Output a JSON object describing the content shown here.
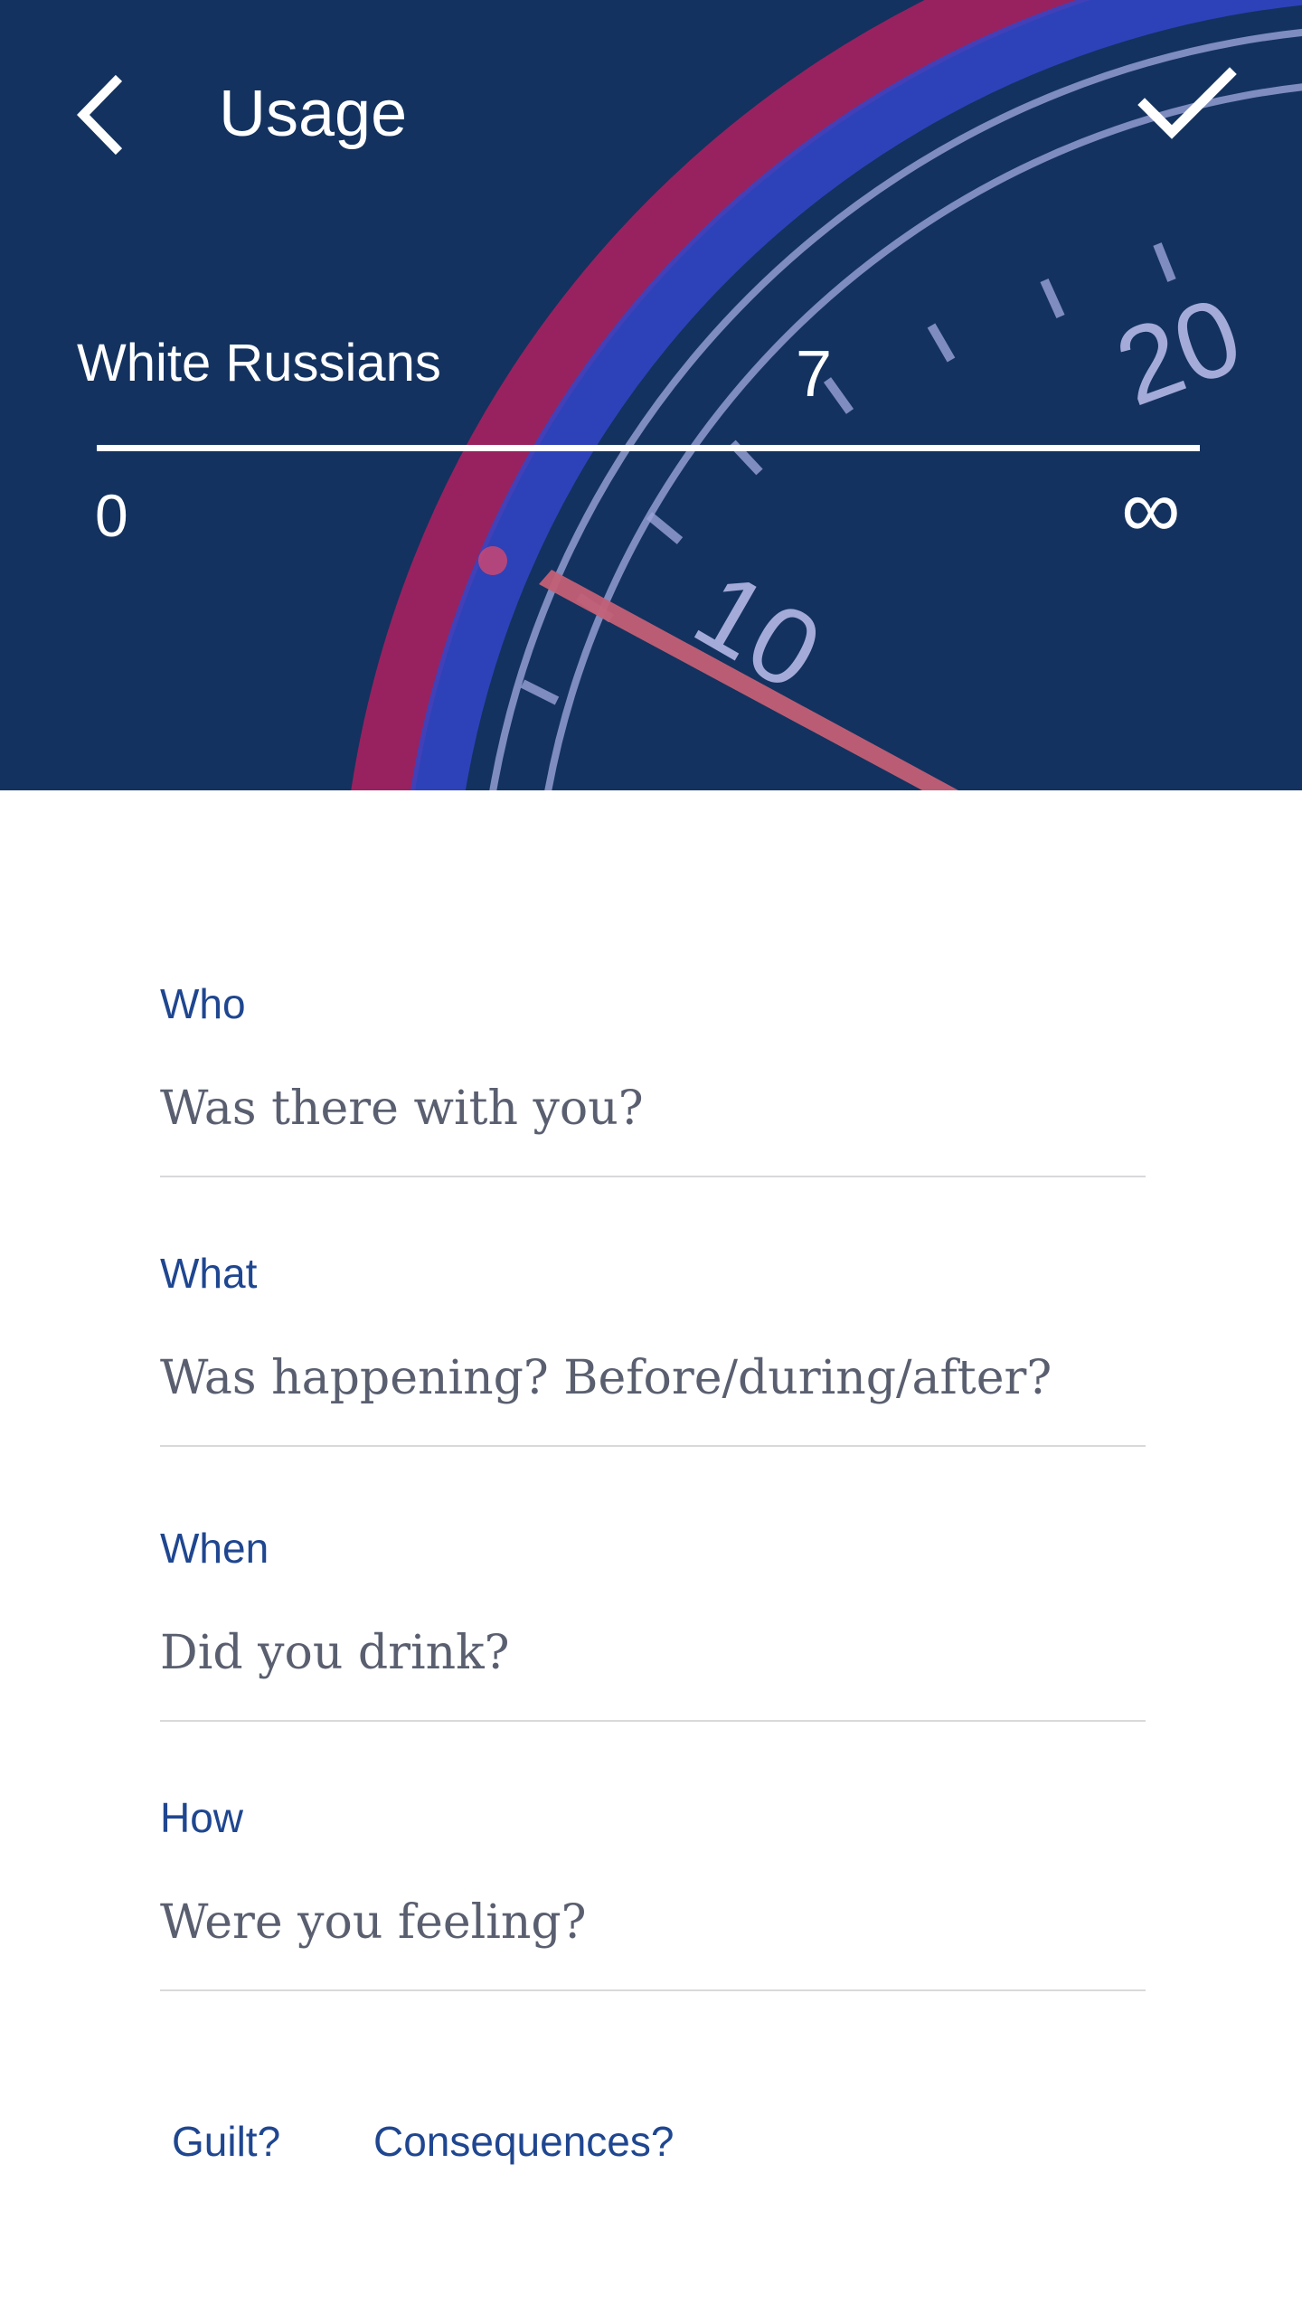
{
  "header": {
    "title": "Usage",
    "drink_name": "White Russians",
    "count": "7",
    "slider": {
      "min_label": "0",
      "max_label": "∞",
      "value": 7
    },
    "gauge_labels": [
      "20",
      "10"
    ]
  },
  "fields": [
    {
      "label": "Who",
      "placeholder": "Was there with you?"
    },
    {
      "label": "What",
      "placeholder": "Was happening? Before/during/after?"
    },
    {
      "label": "When",
      "placeholder": "Did you drink?"
    },
    {
      "label": "How",
      "placeholder": "Were you feeling?"
    }
  ],
  "links": {
    "guilt": "Guilt?",
    "consequences": "Consequences?"
  },
  "colors": {
    "header_bg": "#13325f",
    "accent": "#1f4690",
    "gauge_red": "#e0245e",
    "gauge_blue": "#3a4fd6"
  }
}
